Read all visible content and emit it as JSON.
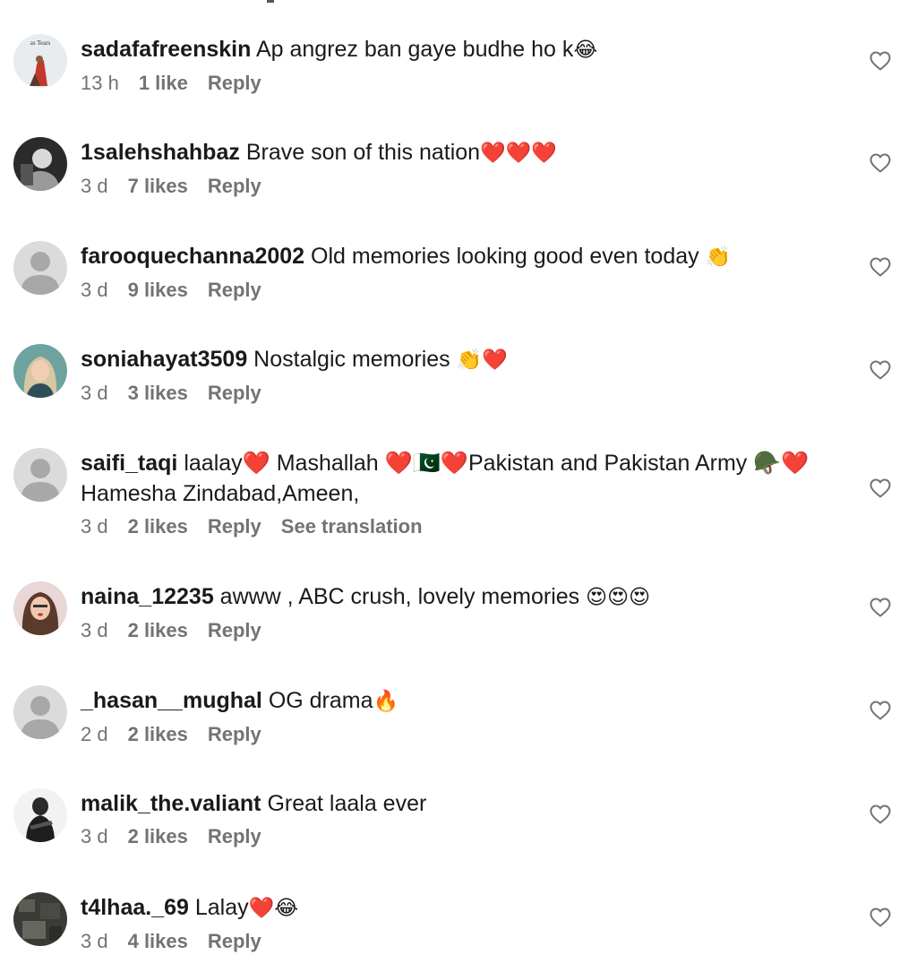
{
  "comments": [
    {
      "username": "sadafafreenskin",
      "text": "Ap angrez ban gaye budhe ho k",
      "emoji": "😂",
      "time": "13 h",
      "likes": "1 like",
      "reply": "Reply",
      "avatar_text": "as Tears"
    },
    {
      "username": "1salehshahbaz",
      "text": "Brave son of this nation",
      "emoji": "❤️❤️❤️",
      "time": "3 d",
      "likes": "7 likes",
      "reply": "Reply"
    },
    {
      "username": "farooquechanna2002",
      "text": "Old memories looking good even today ",
      "emoji": "👏",
      "time": "3 d",
      "likes": "9 likes",
      "reply": "Reply"
    },
    {
      "username": "soniahayat3509",
      "text": "Nostalgic memories ",
      "emoji": "👏❤️",
      "time": "3 d",
      "likes": "3 likes",
      "reply": "Reply"
    },
    {
      "username": "saifi_taqi",
      "text": "laalay❤️ Mashallah ❤️🇵🇰❤️Pakistan and Pakistan Army 🪖❤️ Hamesha Zindabad,Ameen,",
      "time": "3 d",
      "likes": "2 likes",
      "reply": "Reply",
      "translate": "See translation"
    },
    {
      "username": "naina_12235",
      "text": "awww , ABC crush, lovely memories ",
      "emoji": "😍😍😍",
      "time": "3 d",
      "likes": "2 likes",
      "reply": "Reply"
    },
    {
      "username": "_hasan__mughal",
      "text": "OG drama",
      "emoji": "🔥",
      "time": "2 d",
      "likes": "2 likes",
      "reply": "Reply"
    },
    {
      "username": "malik_the.valiant",
      "text": "Great laala ever",
      "time": "3 d",
      "likes": "2 likes",
      "reply": "Reply"
    },
    {
      "username": "t4lhaa._69",
      "text": "Lalay",
      "emoji": "❤️😂",
      "time": "3 d",
      "likes": "4 likes",
      "reply": "Reply"
    }
  ],
  "icons": {
    "like": "heart-outline-icon",
    "default_avatar": "person-silhouette-icon"
  },
  "colors": {
    "meta_gray": "#737373",
    "default_avatar_bg": "#dbdbdb",
    "default_avatar_fg": "#a8a8a8"
  }
}
